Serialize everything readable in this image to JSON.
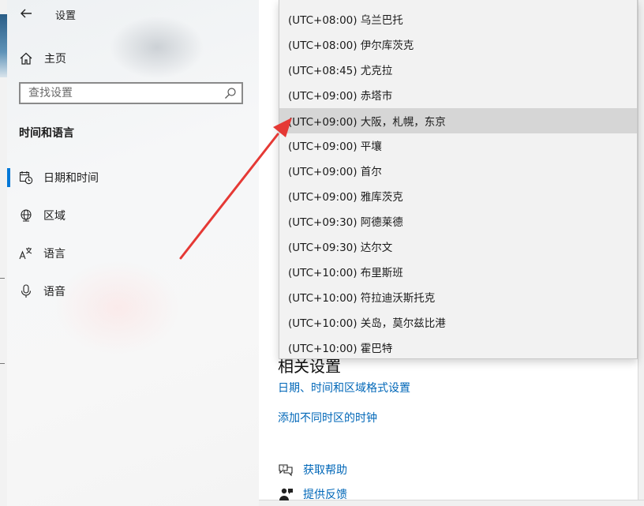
{
  "window": {
    "title": "设置",
    "back_icon": "back-arrow-icon"
  },
  "sidebar": {
    "home_label": "主页",
    "search_placeholder": "查找设置",
    "section_title": "时间和语言",
    "items": [
      {
        "label": "日期和时间",
        "icon": "calendar-clock-icon",
        "active": true
      },
      {
        "label": "区域",
        "icon": "globe-icon",
        "active": false
      },
      {
        "label": "语言",
        "icon": "language-icon",
        "active": false
      },
      {
        "label": "语音",
        "icon": "microphone-icon",
        "active": false
      }
    ]
  },
  "timezone_dropdown": {
    "options": [
      "(UTC+08:00) 乌兰巴托",
      "(UTC+08:00) 伊尔库茨克",
      "(UTC+08:45) 尤克拉",
      "(UTC+09:00) 赤塔市",
      "(UTC+09:00) 大阪，札幌，东京",
      "(UTC+09:00) 平壤",
      "(UTC+09:00) 首尔",
      "(UTC+09:00) 雅库茨克",
      "(UTC+09:30) 阿德莱德",
      "(UTC+09:30) 达尔文",
      "(UTC+10:00) 布里斯班",
      "(UTC+10:00) 符拉迪沃斯托克",
      "(UTC+10:00) 关岛，莫尔兹比港",
      "(UTC+10:00) 霍巴特"
    ],
    "highlighted": "(UTC+09:00) 大阪，札幌，东京"
  },
  "related": {
    "title": "相关设置",
    "link_region_format": "日期、时间和区域格式设置",
    "link_add_clocks": "添加不同时区的时钟"
  },
  "help": {
    "get_help": "获取帮助",
    "feedback": "提供反馈"
  },
  "colors": {
    "accent": "#0078d7",
    "link": "#0067b8",
    "annotation_arrow": "#e53935",
    "hover_row": "#d6d6d6"
  }
}
